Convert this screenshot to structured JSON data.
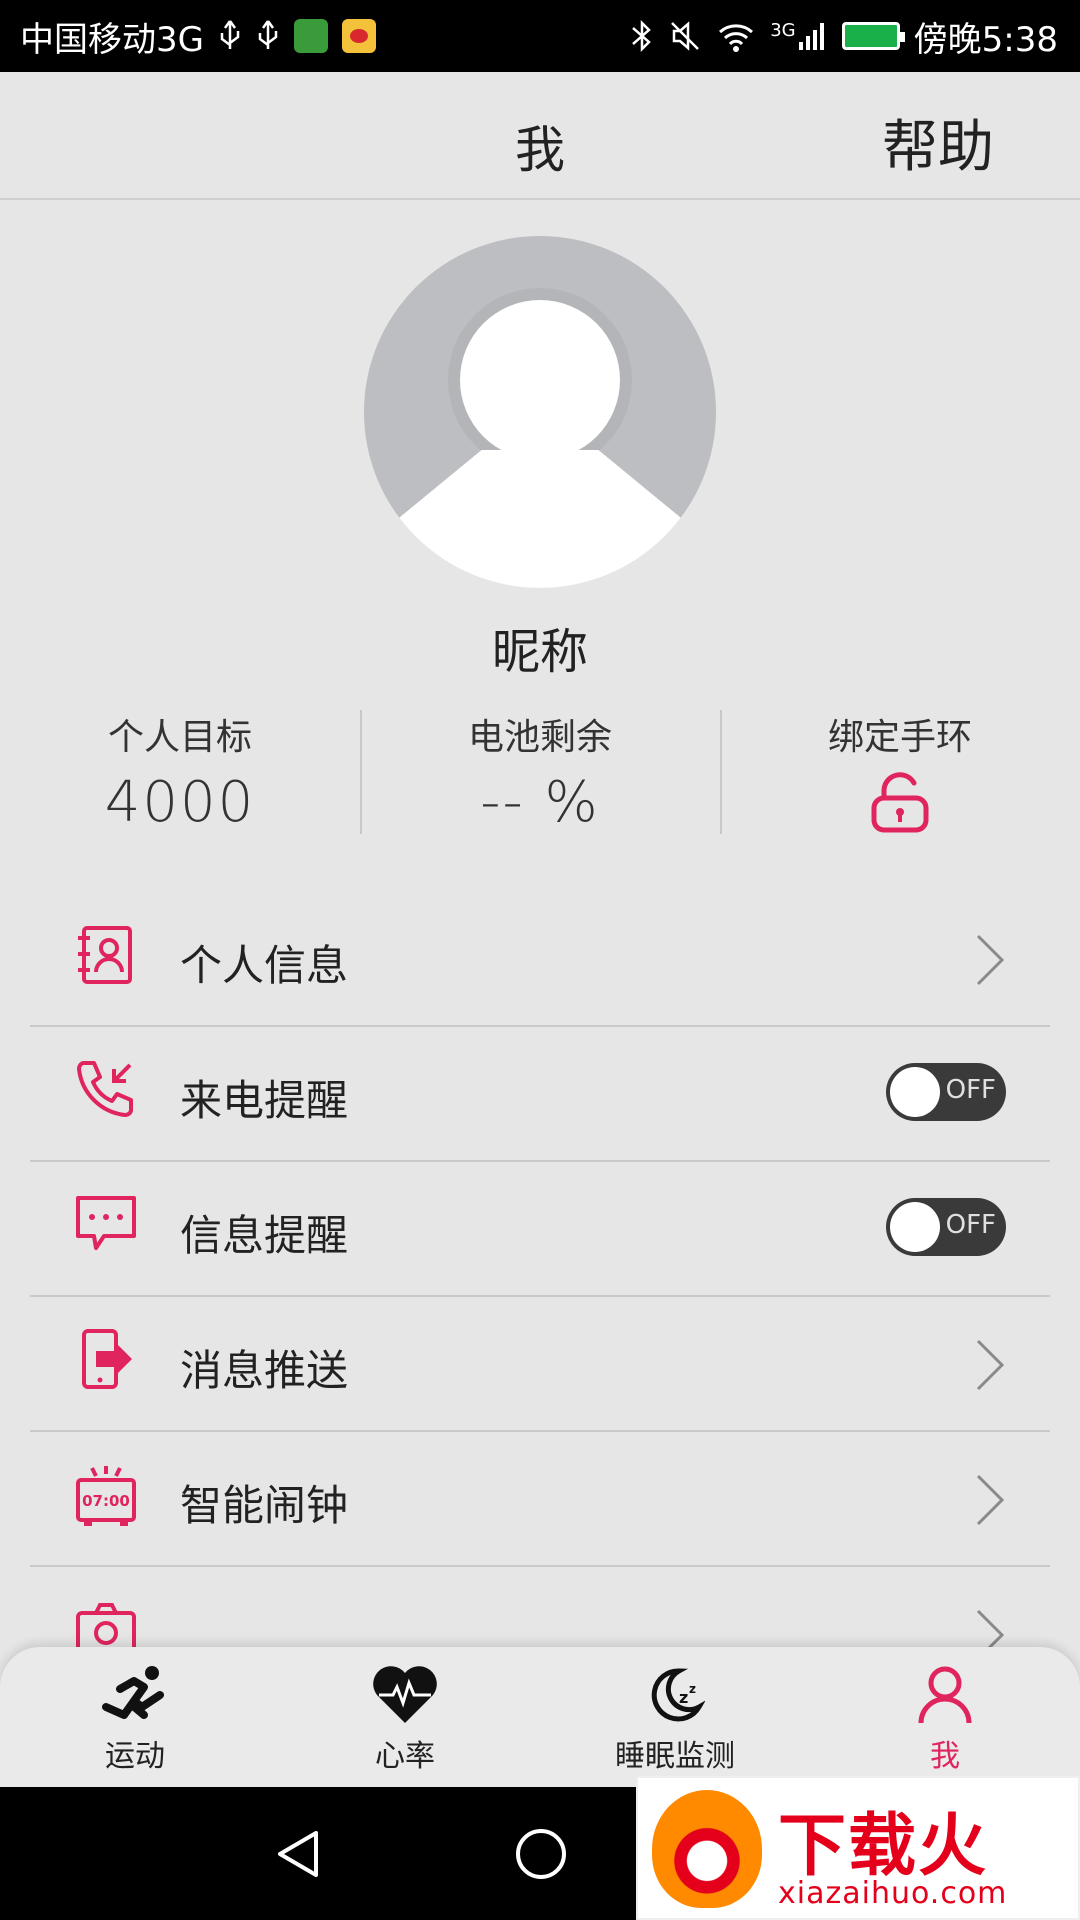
{
  "status_bar": {
    "carrier": "中国移动3G",
    "network": "3G",
    "time": "傍晚5:38"
  },
  "header": {
    "title": "我",
    "help": "帮助"
  },
  "profile": {
    "nickname": "昵称",
    "stats": {
      "goal_label": "个人目标",
      "goal_value": "4000",
      "battery_label": "电池剩余",
      "battery_value": "-- %",
      "bind_label": "绑定手环"
    }
  },
  "menu": {
    "personal_info": "个人信息",
    "call_reminder": "来电提醒",
    "call_toggle": "OFF",
    "message_reminder": "信息提醒",
    "message_toggle": "OFF",
    "push": "消息推送",
    "alarm": "智能闹钟",
    "alarm_icon_text": "07:00"
  },
  "tabs": {
    "sport": "运动",
    "heart": "心率",
    "sleep": "睡眠监测",
    "me": "我"
  },
  "watermark": {
    "title": "下载火",
    "url": "xiazaihuo.com"
  },
  "colors": {
    "accent": "#e0245e",
    "toggle_off": "#3a3a3a",
    "background": "#e6e6e6"
  }
}
